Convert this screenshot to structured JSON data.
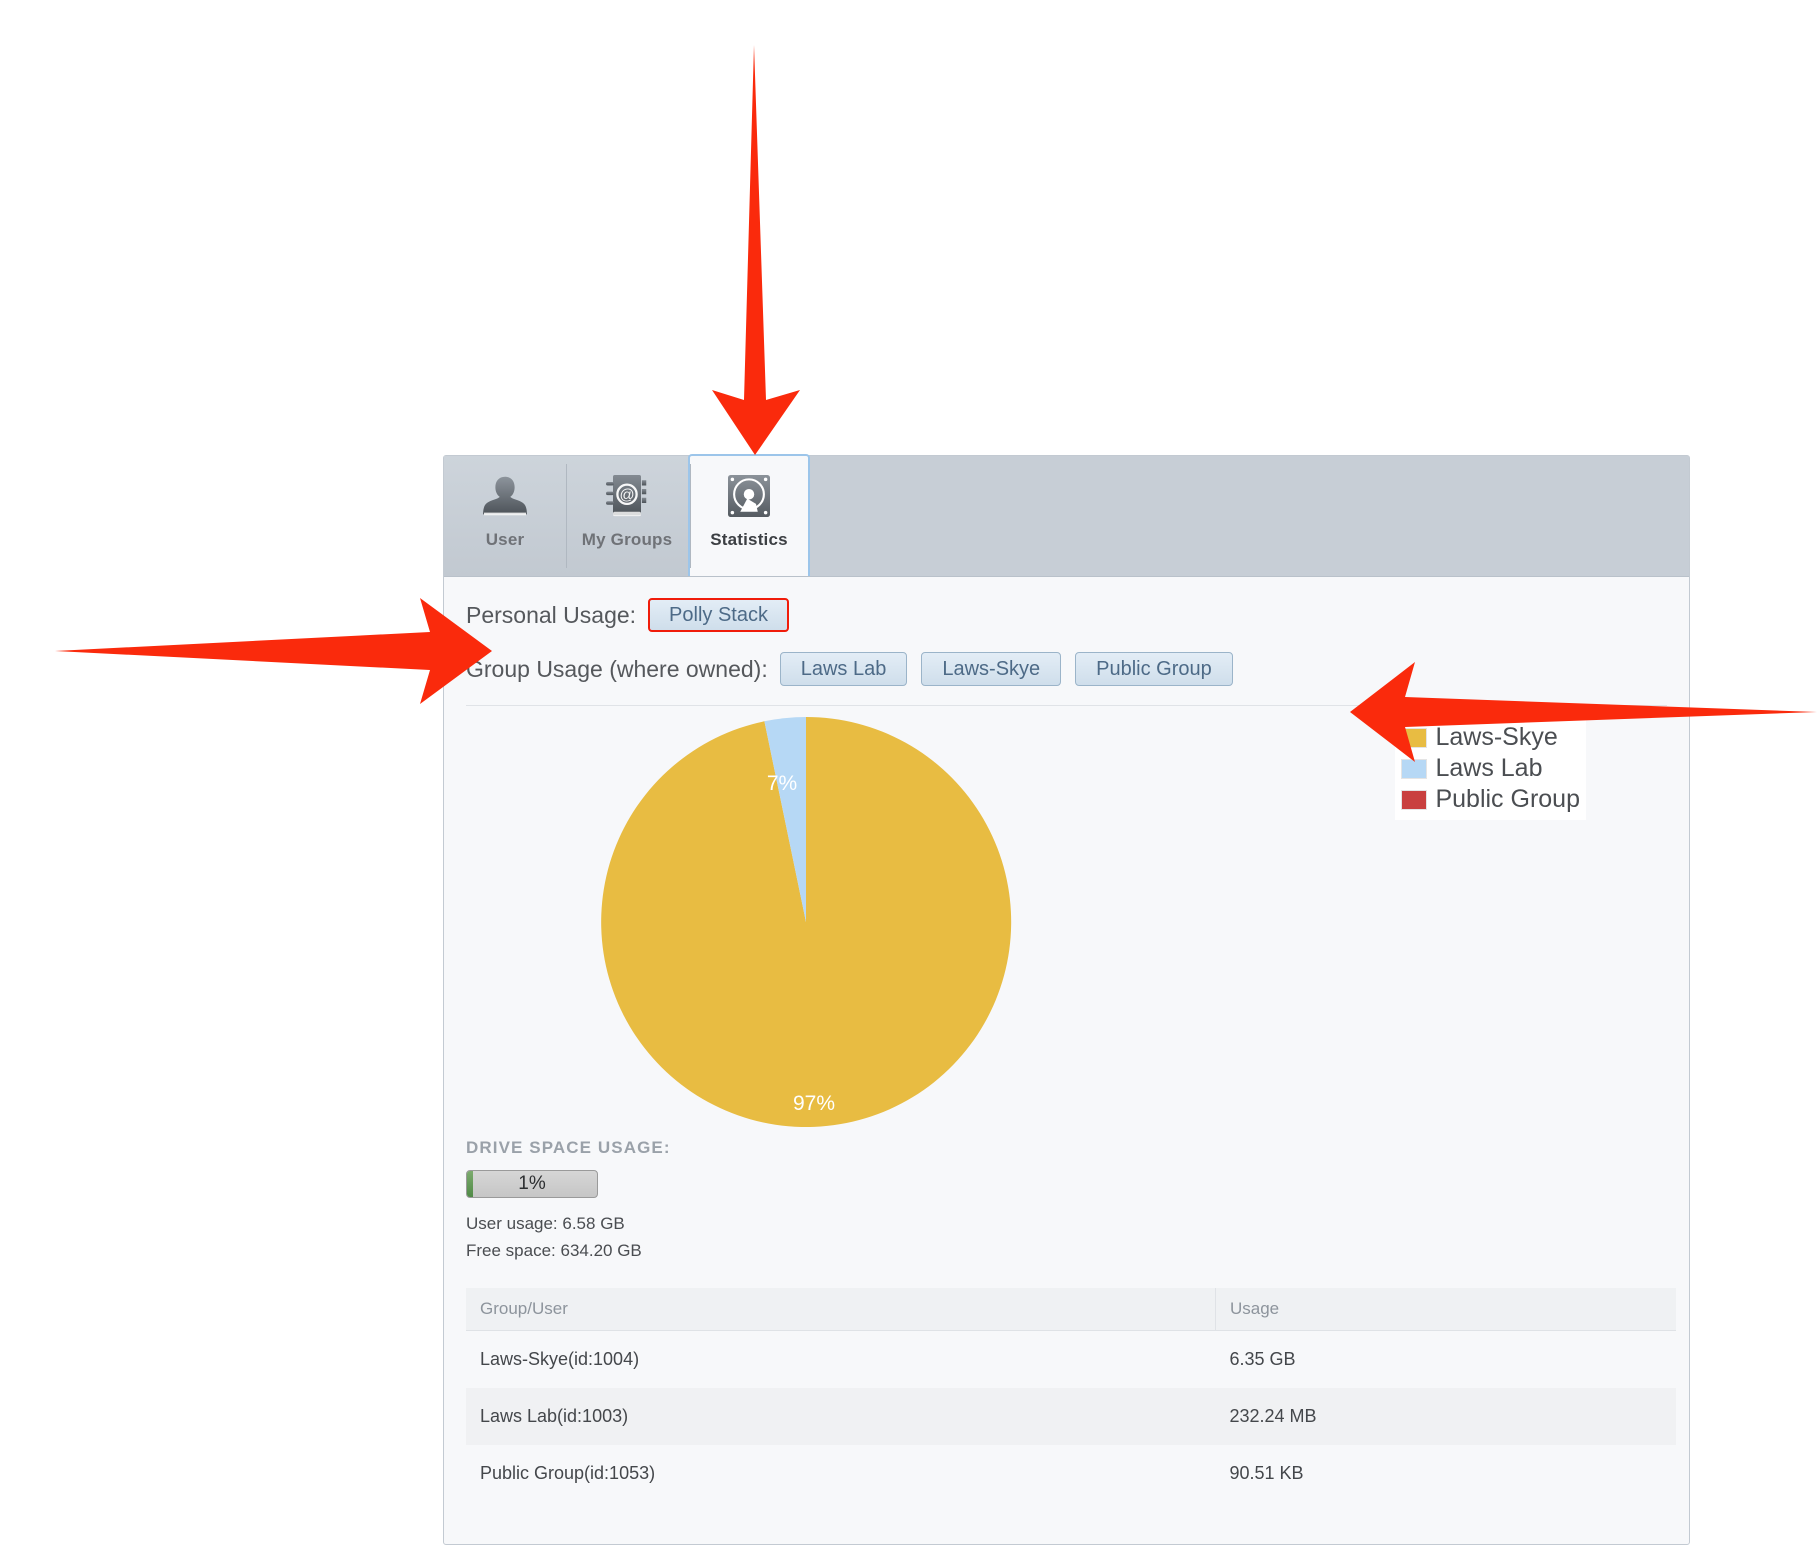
{
  "panel": {
    "tabs": [
      {
        "id": "user",
        "label": "User",
        "icon": "user-icon",
        "active": false
      },
      {
        "id": "my-groups",
        "label": "My Groups",
        "icon": "address-book-icon",
        "active": false
      },
      {
        "id": "statistics",
        "label": "Statistics",
        "icon": "hard-drive-icon",
        "active": true
      }
    ],
    "personal": {
      "label": "Personal Usage:",
      "button": "Polly Stack"
    },
    "group": {
      "label": "Group Usage (where owned):",
      "buttons": [
        "Laws Lab",
        "Laws-Skye",
        "Public Group"
      ]
    },
    "drive": {
      "title": "DRIVE SPACE USAGE:",
      "percent_label": "1%",
      "percent_value": 1,
      "user_usage": "User usage: 6.58 GB",
      "free_space": "Free space: 634.20 GB"
    },
    "table": {
      "headers": [
        "Group/User",
        "Usage"
      ],
      "rows": [
        {
          "name": "Laws-Skye(id:1004)",
          "usage": "6.35 GB"
        },
        {
          "name": "Laws Lab(id:1003)",
          "usage": "232.24 MB"
        },
        {
          "name": "Public Group(id:1053)",
          "usage": "90.51 KB"
        }
      ]
    }
  },
  "chart_data": {
    "type": "pie",
    "title": "",
    "categories": [
      "Laws-Skye",
      "Laws Lab",
      "Public Group"
    ],
    "values": [
      97,
      7,
      0
    ],
    "slice_labels": [
      "97%",
      "7%"
    ],
    "colors": [
      "#e8bc42",
      "#b6d8f5",
      "#c9403f"
    ],
    "legend": [
      {
        "label": "Laws-Skye",
        "color": "#e8bc42"
      },
      {
        "label": "Laws Lab",
        "color": "#b6d8f5"
      },
      {
        "label": "Public Group",
        "color": "#c9403f"
      }
    ],
    "legend_position": "right",
    "grid": false
  },
  "annotations": {
    "arrow_color": "#fa2a0c",
    "arrows": [
      {
        "name": "arrow-to-statistics-tab",
        "direction": "down"
      },
      {
        "name": "arrow-to-personal-usage",
        "direction": "right"
      },
      {
        "name": "arrow-to-group-usage-buttons",
        "direction": "left"
      }
    ]
  }
}
